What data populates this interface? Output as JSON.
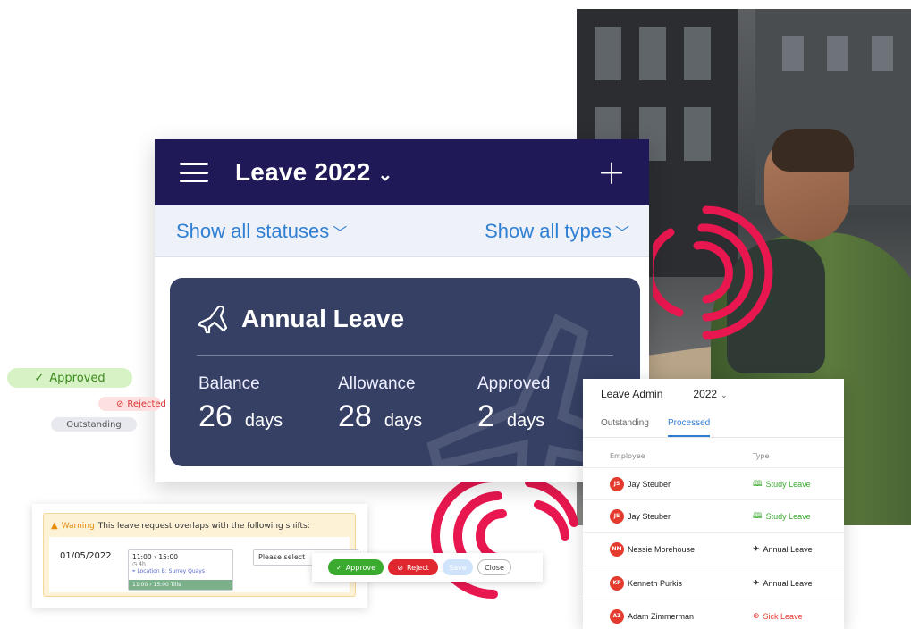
{
  "app": {
    "title": "Leave 2022",
    "filter_status": "Show all statuses",
    "filter_type": "Show all types"
  },
  "card": {
    "title": "Annual Leave",
    "stats": [
      {
        "label": "Balance",
        "value": "26",
        "unit": "days"
      },
      {
        "label": "Allowance",
        "value": "28",
        "unit": "days"
      },
      {
        "label": "Approved",
        "value": "2",
        "unit": "days"
      }
    ]
  },
  "status_chips": {
    "approved": "Approved",
    "rejected": "Rejected",
    "outstanding": "Outstanding"
  },
  "warning": {
    "label": "Warning",
    "message": "This leave request overlaps with the following shifts:",
    "date": "01/05/2022",
    "shift_time": "11:00 › 15:00",
    "shift_duration": "4h",
    "shift_location": "Location B: Surrey Quays",
    "shift_bar": "11:00 › 15:00   Tills",
    "select_placeholder": "Please select"
  },
  "actions": {
    "approve": "Approve",
    "reject": "Reject",
    "save": "Save",
    "close": "Close"
  },
  "admin": {
    "title": "Leave Admin",
    "year": "2022",
    "tabs": [
      "Outstanding",
      "Processed"
    ],
    "columns": [
      "Employee",
      "Type"
    ],
    "rows": [
      {
        "initials": "JS",
        "name": "Jay Steuber",
        "type": "Study Leave",
        "type_color": "#3aab2f"
      },
      {
        "initials": "JS",
        "name": "Jay Steuber",
        "type": "Study Leave",
        "type_color": "#3aab2f"
      },
      {
        "initials": "NM",
        "name": "Nessie Morehouse",
        "type": "Annual Leave",
        "type_color": "#222222"
      },
      {
        "initials": "KP",
        "name": "Kenneth Purkis",
        "type": "Annual Leave",
        "type_color": "#222222"
      },
      {
        "initials": "AZ",
        "name": "Adam Zimmerman",
        "type": "Sick Leave",
        "type_color": "#e53a2e"
      }
    ]
  },
  "colors": {
    "header_navy": "#1f1a57",
    "card_slate": "#354064",
    "link_blue": "#2f7fd3",
    "accent_red": "#e8174f"
  }
}
